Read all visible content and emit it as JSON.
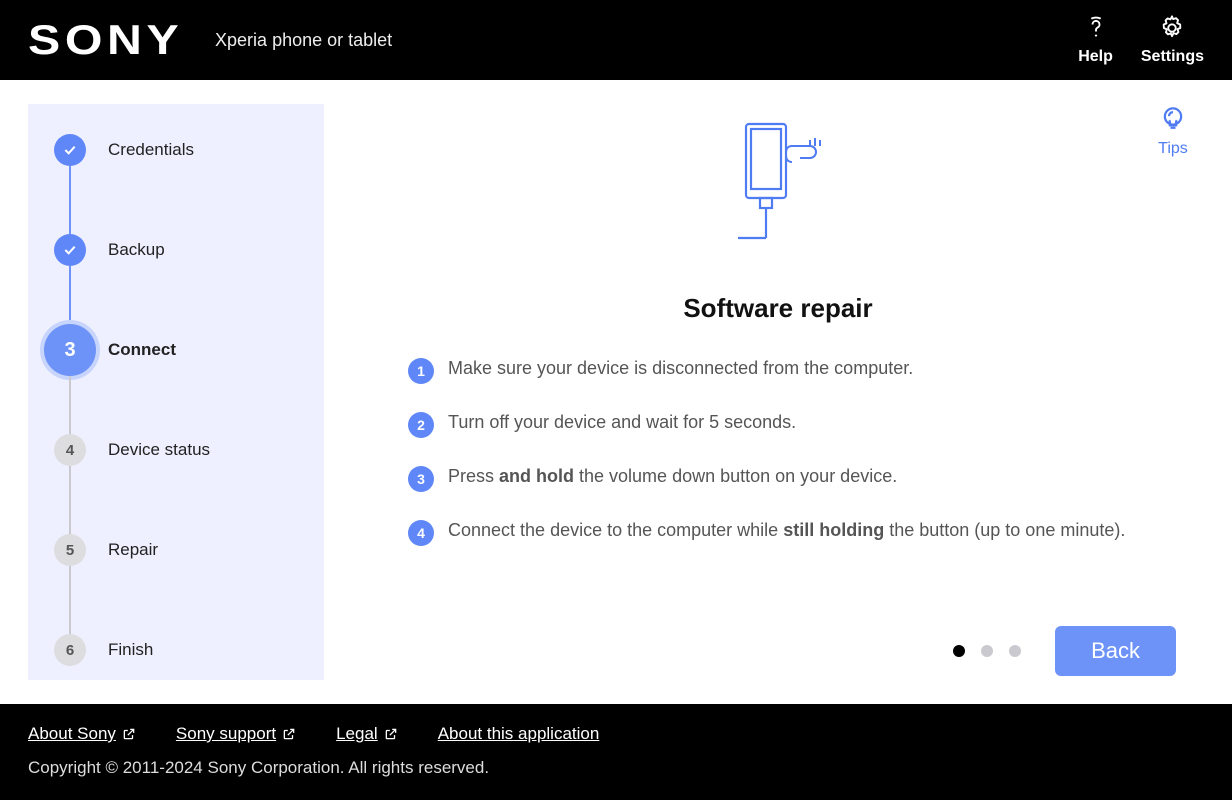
{
  "header": {
    "logo": "SONY",
    "subtitle": "Xperia phone or tablet",
    "help_label": "Help",
    "settings_label": "Settings"
  },
  "sidebar": {
    "steps": [
      {
        "label": "Credentials",
        "state": "done"
      },
      {
        "label": "Backup",
        "state": "done"
      },
      {
        "label": "Connect",
        "state": "current",
        "num": "3"
      },
      {
        "label": "Device status",
        "state": "todo",
        "num": "4"
      },
      {
        "label": "Repair",
        "state": "todo",
        "num": "5"
      },
      {
        "label": "Finish",
        "state": "todo",
        "num": "6"
      }
    ]
  },
  "main": {
    "tips_label": "Tips",
    "title": "Software repair",
    "instructions": [
      {
        "n": "1",
        "html": "Make sure your device is disconnected from the computer."
      },
      {
        "n": "2",
        "html": "Turn off your device and wait for 5 seconds."
      },
      {
        "n": "3",
        "html": "Press <b>and hold</b> the volume down button on your device."
      },
      {
        "n": "4",
        "html": "Connect the device to the computer while <b>still holding</b> the button (up to one minute)."
      }
    ],
    "dots": {
      "count": 3,
      "active": 0
    },
    "back_label": "Back"
  },
  "footer": {
    "links": [
      {
        "label": "About Sony",
        "external": true
      },
      {
        "label": "Sony support",
        "external": true
      },
      {
        "label": "Legal",
        "external": true
      },
      {
        "label": "About this application",
        "external": false
      }
    ],
    "copyright": "Copyright © 2011-2024 Sony Corporation. All rights reserved."
  }
}
